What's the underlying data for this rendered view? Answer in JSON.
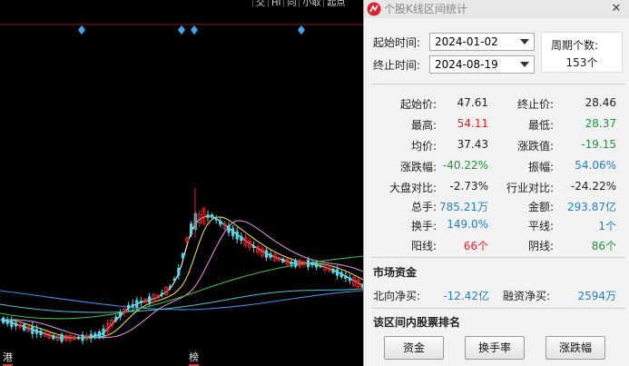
{
  "top_menu": [
    "交",
    "HI",
    "同",
    "小取",
    "起点"
  ],
  "chart_tags": [
    "港",
    "榜"
  ],
  "dialog": {
    "title": "个股K线区间统计",
    "close": "✕",
    "start_label": "起始时间:",
    "start_value": "2024-01-02",
    "end_label": "终止时间:",
    "end_value": "2024-08-19",
    "period_label": "周期个数:",
    "period_value": "153个"
  },
  "stats": [
    {
      "l1": "起始价:",
      "v1": "47.61",
      "c1": "#222222",
      "l2": "终止价:",
      "v2": "28.46",
      "c2": "#222222"
    },
    {
      "l1": "最高:",
      "v1": "54.11",
      "c1": "#e0262b",
      "l2": "最低:",
      "v2": "28.37",
      "c2": "#1a9a3a"
    },
    {
      "l1": "均价:",
      "v1": "37.43",
      "c1": "#222222",
      "l2": "涨跌值:",
      "v2": "-19.15",
      "c2": "#1a9a3a"
    },
    {
      "l1": "涨跌幅:",
      "v1": "-40.22%",
      "c1": "#1a9a3a",
      "l2": "振幅:",
      "v2": "54.06%",
      "c2": "#1f7fc8"
    },
    {
      "l1": "大盘对比:",
      "v1": "-2.73%",
      "c1": "#222222",
      "l2": "行业对比:",
      "v2": "-24.22%",
      "c2": "#222222"
    },
    {
      "l1": "总手:",
      "v1": "785.21万",
      "c1": "#1f7fc8",
      "l2": "金额:",
      "v2": "293.87亿",
      "c2": "#1f7fc8"
    },
    {
      "l1": "换手:",
      "v1": "149.0%",
      "c1": "#1f7fc8",
      "l2": "平线:",
      "v2": "1个",
      "c2": "#1f7fc8"
    },
    {
      "l1": "阳线:",
      "v1": "66个",
      "c1": "#e0262b",
      "l2": "阴线:",
      "v2": "86个",
      "c2": "#1a9a3a"
    }
  ],
  "fund": {
    "title": "市场资金",
    "north_label": "北向净买:",
    "north_value": "-12.42亿",
    "margin_label": "融资净买:",
    "margin_value": "2594万"
  },
  "ranking": {
    "title": "该区间内股票排名",
    "buttons": [
      "资金",
      "换手率",
      "涨跌幅"
    ]
  },
  "colors": {
    "rise": "#e0262b",
    "fall": "#1a9a3a",
    "accent": "#1f7fc8",
    "candle_down": "#54d9e6",
    "ma5": "#ffffff",
    "ma10": "#ecd548",
    "ma20": "#d98ad8",
    "ma60": "#40c040",
    "ma120": "#3f8fe0"
  }
}
